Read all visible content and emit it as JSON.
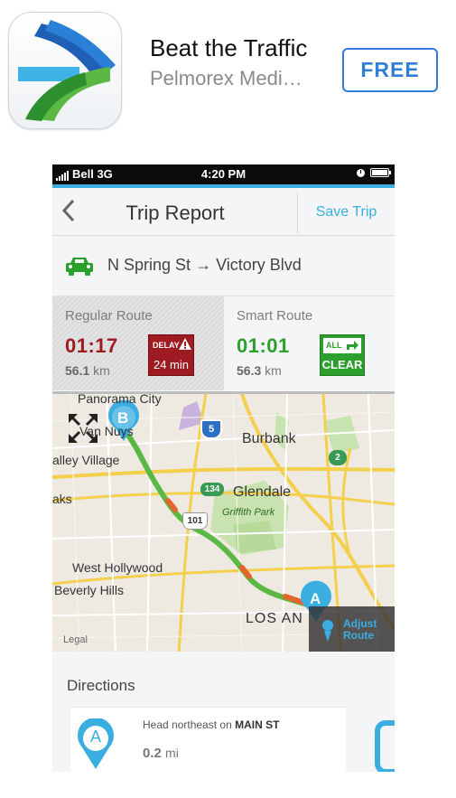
{
  "listing": {
    "app_name": "Beat the Traffic",
    "developer": "Pelmorex Medi…",
    "button_label": "FREE"
  },
  "status_bar": {
    "carrier": "Bell 3G",
    "time": "4:20 PM"
  },
  "nav": {
    "back_icon": "chevron-left-icon",
    "title": "Trip Report",
    "save_label": "Save Trip"
  },
  "route": {
    "icon": "car-icon",
    "from": "N Spring St",
    "arrow": "→",
    "to": "Victory Blvd"
  },
  "regular_route": {
    "label": "Regular Route",
    "time": "01:17",
    "distance": "56.1",
    "unit": "km",
    "badge_top": "DELAY",
    "badge_value": "24 min"
  },
  "smart_route": {
    "label": "Smart Route",
    "time": "01:01",
    "distance": "56.3",
    "unit": "km",
    "badge_top": "ALL",
    "badge_value": "CLEAR"
  },
  "map": {
    "labels": {
      "panorama_city": "Panorama City",
      "van_nuys": "Van Nuys",
      "valley_village": "alley Village",
      "oaks": "aks",
      "burbank": "Burbank",
      "glendale": "Glendale",
      "griffith_park": "Griffith Park",
      "west_hollywood": "West Hollywood",
      "beverly_hills": "Beverly Hills",
      "los_angeles": "LOS AN",
      "legal": "Legal"
    },
    "shields": {
      "i5": "5",
      "r134": "134",
      "r101": "101",
      "r2": "2"
    },
    "pin_start": "A",
    "pin_end": "B",
    "adjust_label_1": "Adjust",
    "adjust_label_2": "Route"
  },
  "directions": {
    "title": "Directions",
    "pin": "A",
    "step_prefix": "Head northeast on",
    "step_street": "MAIN ST",
    "distance": "0.2",
    "unit": "mi"
  },
  "colors": {
    "accent": "#3aaee0",
    "delay_red": "#9e1b22",
    "clear_green": "#2c9f2c",
    "free_blue": "#2f7fd6"
  }
}
